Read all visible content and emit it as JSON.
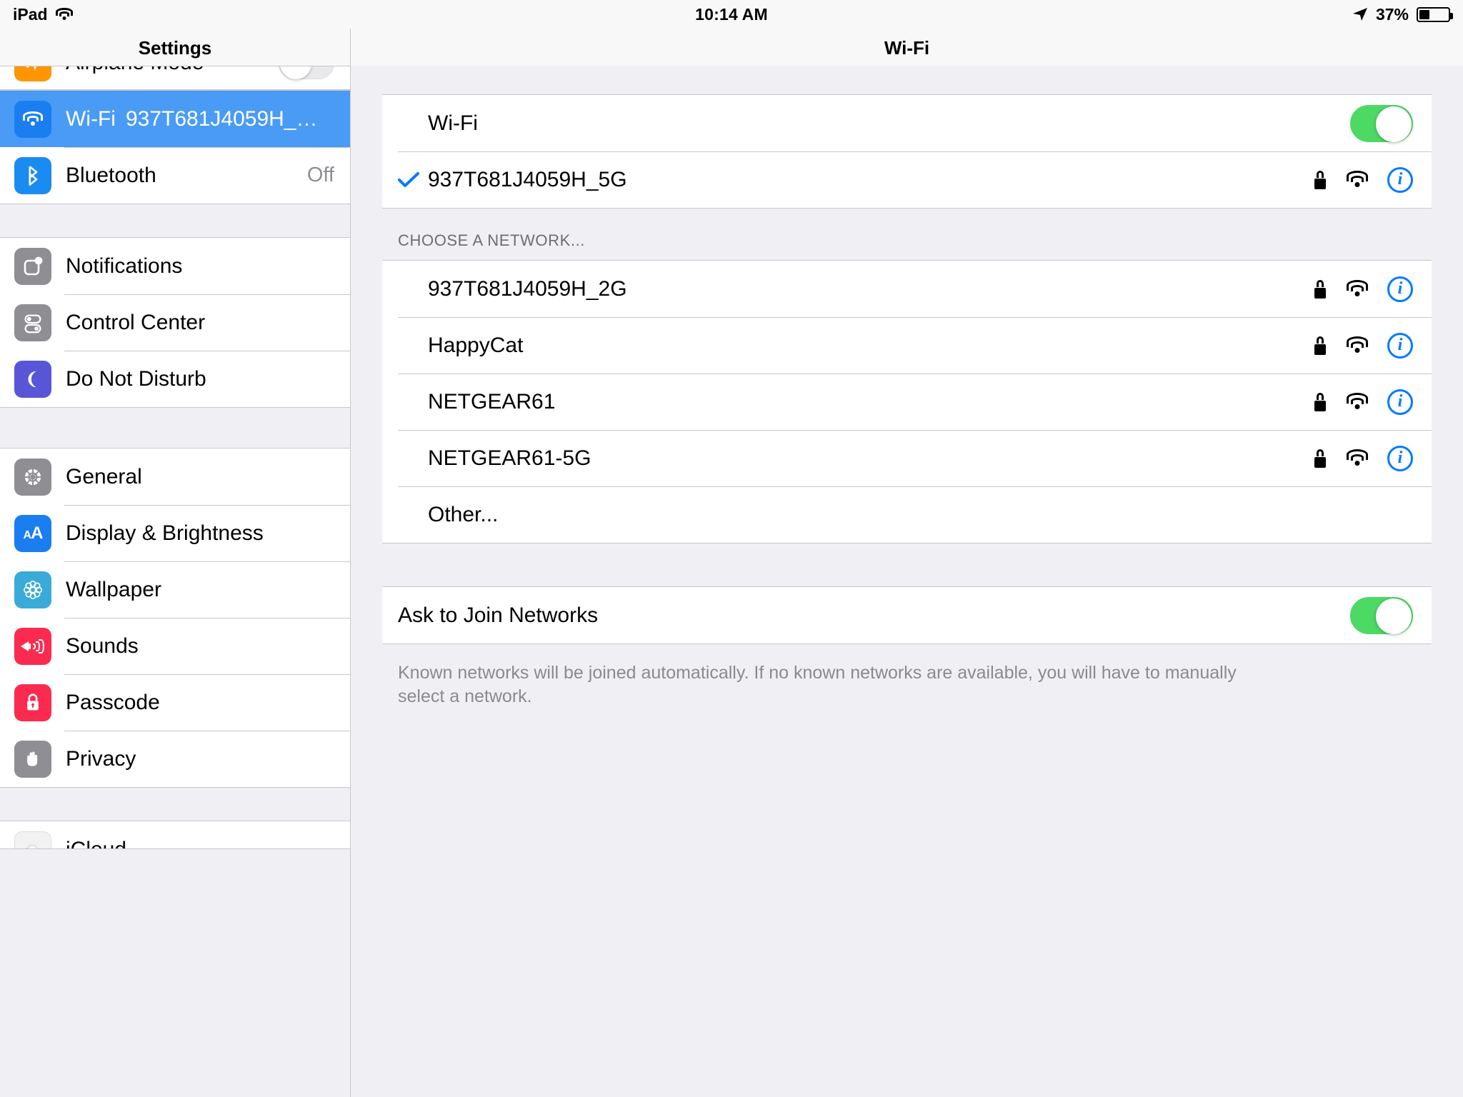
{
  "statusbar": {
    "device": "iPad",
    "wifi_icon": "wifi-icon",
    "time": "10:14 AM",
    "location_icon": "location-arrow-icon",
    "battery_percent": "37%",
    "battery_level": 37
  },
  "sidebar": {
    "title": "Settings",
    "groups": [
      {
        "clipped": true,
        "items": [
          {
            "label": "Airplane Mode",
            "icon": "airplane-icon",
            "icon_class": "ico-airplane",
            "control": "toggle",
            "toggle_on": false
          }
        ]
      },
      {
        "items": [
          {
            "label": "Wi-Fi",
            "value": "937T681J4059H_…",
            "icon": "wifi-icon",
            "icon_class": "ico-wifi",
            "selected": true
          },
          {
            "label": "Bluetooth",
            "value": "Off",
            "icon": "bluetooth-icon",
            "icon_class": "ico-bt"
          }
        ]
      },
      {
        "items": [
          {
            "label": "Notifications",
            "icon": "notifications-icon",
            "icon_class": "ico-notif"
          },
          {
            "label": "Control Center",
            "icon": "control-center-icon",
            "icon_class": "ico-cc"
          },
          {
            "label": "Do Not Disturb",
            "icon": "moon-icon",
            "icon_class": "ico-dnd"
          }
        ]
      },
      {
        "items": [
          {
            "label": "General",
            "icon": "gear-icon",
            "icon_class": "ico-general"
          },
          {
            "label": "Display & Brightness",
            "icon": "text-size-icon",
            "icon_class": "ico-display"
          },
          {
            "label": "Wallpaper",
            "icon": "flower-icon",
            "icon_class": "ico-wallpaper"
          },
          {
            "label": "Sounds",
            "icon": "speaker-icon",
            "icon_class": "ico-sounds"
          },
          {
            "label": "Passcode",
            "icon": "lock-icon",
            "icon_class": "ico-passcode"
          },
          {
            "label": "Privacy",
            "icon": "hand-icon",
            "icon_class": "ico-privacy"
          }
        ]
      },
      {
        "items": [
          {
            "label": "iCloud",
            "icon": "cloud-icon",
            "icon_class": "ico-icloud"
          }
        ]
      }
    ]
  },
  "pane": {
    "title": "Wi-Fi",
    "wifi_row": {
      "label": "Wi-Fi",
      "toggle_on": true
    },
    "connected_network": {
      "ssid": "937T681J4059H_5G",
      "connected": true,
      "check_icon": "checkmark-icon",
      "secured": true,
      "lock_icon": "lock-icon",
      "signal_icon": "wifi-signal-icon",
      "info_icon": "info-icon",
      "info_label": "i"
    },
    "section_header": "CHOOSE A NETWORK...",
    "networks": [
      {
        "ssid": "937T681J4059H_2G",
        "secured": true,
        "has_signal": true,
        "has_info": true
      },
      {
        "ssid": "HappyCat",
        "secured": true,
        "has_signal": true,
        "has_info": true
      },
      {
        "ssid": "NETGEAR61",
        "secured": true,
        "has_signal": true,
        "has_info": true
      },
      {
        "ssid": "NETGEAR61-5G",
        "secured": true,
        "has_signal": true,
        "has_info": true
      },
      {
        "ssid": "Other...",
        "secured": false,
        "has_signal": false,
        "has_info": false
      }
    ],
    "ask_to_join": {
      "label": "Ask to Join Networks",
      "toggle_on": true
    },
    "footnote": "Known networks will be joined automatically. If no known networks are available, you will have to manually select a network."
  },
  "colors": {
    "accent_blue": "#007aff",
    "selected_row_blue": "#4a9bf5",
    "toggle_green": "#4cd964",
    "group_bg": "#efeff4",
    "separator": "#c8c7cc",
    "secondary_text": "#8e8e93"
  }
}
